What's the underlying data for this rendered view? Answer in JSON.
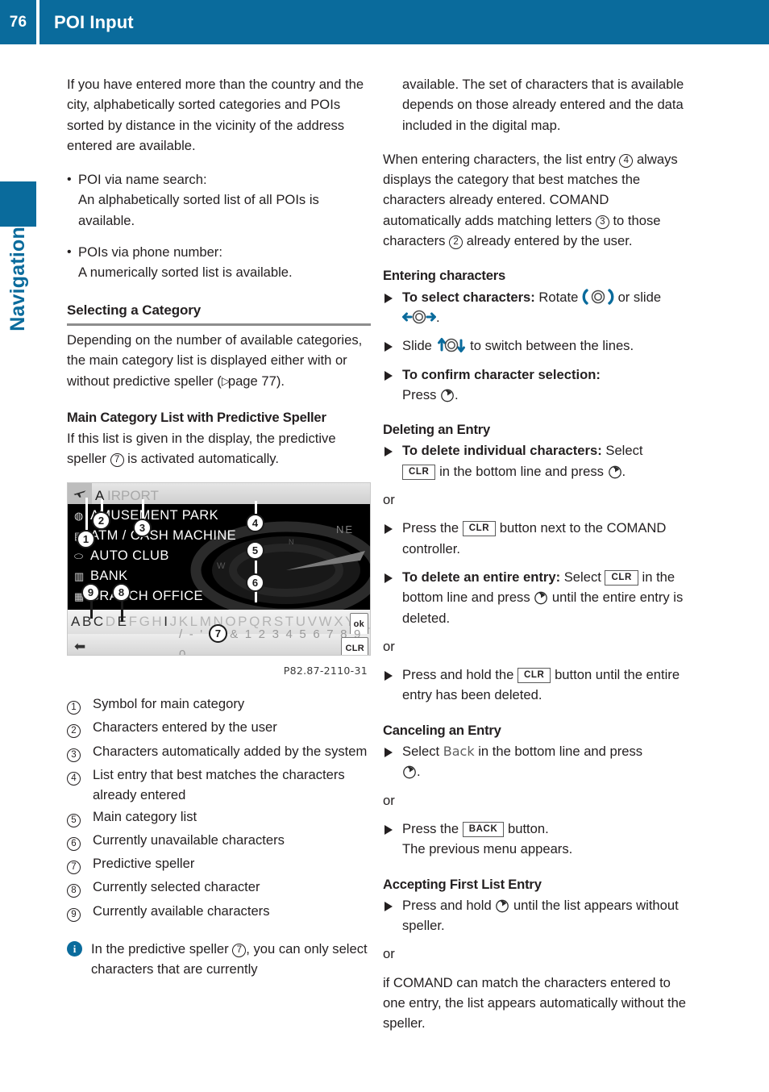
{
  "header": {
    "page_number": "76",
    "title": "POI Input",
    "accent_color": "#0a6b9c"
  },
  "side_tab": {
    "label": "Navigation"
  },
  "left_column": {
    "intro_paragraph": "If you have entered more than the country and the city, alphabetically sorted categories and POIs sorted by distance in the vicinity of the address entered are available.",
    "bullets": [
      {
        "line1": "POI via name search:",
        "line2": "An alphabetically sorted list of all POIs is available."
      },
      {
        "line1": "POIs via phone number:",
        "line2": "A numerically sorted list is available."
      }
    ],
    "section_heading": "Selecting a Category",
    "section_paragraph_a": "Depending on the number of available categories, the main category list is displayed either with or without predictive speller (",
    "section_paragraph_page_ref": "page 77",
    "section_paragraph_b": ").",
    "sub_heading": "Main Category List with Predictive Speller",
    "sub_paragraph_a": "If this list is given in the display, the predictive speller",
    "sub_paragraph_ref": "7",
    "sub_paragraph_b": "is activated automatically.",
    "figure": {
      "caption": "P82.87-2110-31",
      "top_row": {
        "main_category_icon": "airplane-icon",
        "entered_characters": "A",
        "auto_added_characters": "IRPORT"
      },
      "list_items": [
        {
          "icon": "ferris-wheel-icon",
          "label": "AMUSEMENT PARK"
        },
        {
          "icon": "atm-icon",
          "label": "ATM / CASH MACHINE"
        },
        {
          "icon": "auto-club-icon",
          "label": "AUTO CLUB"
        },
        {
          "icon": "bank-icon",
          "label": "BANK"
        },
        {
          "icon": "branch-office-icon",
          "label": "BRANCH OFFICE"
        }
      ],
      "speller_available": "ABC",
      "speller_selected": "E",
      "speller_rest_1": "D",
      "speller_rest_2": "FGH",
      "speller_active_i": "I",
      "speller_rest_3": "JKLMNOPQRSTUVWXYZ_",
      "ok_key": "ok",
      "clr_key": "CLR",
      "symbols_row": "/ - ' . , & 1 2 3 4 5 6 7 8 9 0",
      "back_arrow_icon": "back-arrow-icon",
      "compass_label": "NE",
      "callouts": [
        "1",
        "2",
        "3",
        "4",
        "5",
        "6",
        "7",
        "8",
        "9"
      ]
    },
    "legend": [
      {
        "num": "1",
        "text": "Symbol for main category"
      },
      {
        "num": "2",
        "text": "Characters entered by the user"
      },
      {
        "num": "3",
        "text": "Characters automatically added by the system"
      },
      {
        "num": "4",
        "text": "List entry that best matches the characters already entered"
      },
      {
        "num": "5",
        "text": "Main category list"
      },
      {
        "num": "6",
        "text": "Currently unavailable characters"
      },
      {
        "num": "7",
        "text": "Predictive speller"
      },
      {
        "num": "8",
        "text": "Currently selected character"
      },
      {
        "num": "9",
        "text": "Currently available characters"
      }
    ],
    "note": {
      "icon": "info-icon",
      "text_a": "In the predictive speller",
      "ref": "7",
      "text_b": ", you can only select characters that are currently"
    }
  },
  "right_column": {
    "continuation_paragraph": "available. The set of characters that is available depends on those already entered and the data included in the digital map.",
    "paragraph2_a": "When entering characters, the list entry",
    "paragraph2_ref1": "4",
    "paragraph2_b": "always displays the category that best matches the characters already entered. COMAND automatically adds matching letters",
    "paragraph2_ref2": "3",
    "paragraph2_c": "to those characters",
    "paragraph2_ref3": "2",
    "paragraph2_d": "already entered by the user.",
    "sections": [
      {
        "heading": "Entering characters",
        "steps": [
          {
            "bold": "To select characters:",
            "text_a": "Rotate",
            "glyph1": "rotate-controller-icon",
            "text_b": "or slide",
            "glyph2": "slide-horizontal-controller-icon",
            "text_c": "."
          },
          {
            "bold": "",
            "text_a": "Slide",
            "glyph1": "slide-vertical-controller-icon",
            "text_b": "to switch between the lines.",
            "glyph2": "",
            "text_c": ""
          },
          {
            "bold": "To confirm character selection:",
            "text_a": "Press",
            "glyph1": "press-controller-icon",
            "text_b": "",
            "glyph2": "",
            "text_c": "."
          }
        ]
      },
      {
        "heading": "Deleting an Entry",
        "steps": [
          {
            "bold": "To delete individual characters:",
            "text_a": "Select",
            "key": "CLR",
            "text_b": "in the bottom line and press",
            "glyph": "press-controller-icon",
            "text_c": "."
          },
          {
            "or": "or"
          },
          {
            "bold": "",
            "text_a": "Press the",
            "key": "CLR",
            "text_b": "button next to the COMAND controller.",
            "glyph": "",
            "text_c": ""
          },
          {
            "bold": "To delete an entire entry:",
            "text_a": "Select",
            "key": "CLR",
            "text_b": "in the bottom line and press",
            "glyph": "press-controller-icon",
            "text_c": "until the entire entry is deleted."
          },
          {
            "or": "or"
          },
          {
            "bold": "",
            "text_a": "Press and hold the",
            "key": "CLR",
            "text_b": "button until the entire entry has been deleted.",
            "glyph": "",
            "text_c": ""
          }
        ]
      },
      {
        "heading": "Canceling an Entry",
        "steps": [
          {
            "bold": "",
            "text_a": "Select",
            "ui_label": "Back",
            "text_b": "in the bottom line and press",
            "glyph": "press-controller-icon",
            "text_c": "."
          },
          {
            "or": "or"
          },
          {
            "bold": "",
            "text_a": "Press the",
            "key": "BACK",
            "text_b": "button.",
            "extra_line": "The previous menu appears."
          }
        ]
      },
      {
        "heading": "Accepting First List Entry",
        "steps": [
          {
            "bold": "",
            "text_a": "Press and hold",
            "glyph": "press-controller-icon",
            "text_b": "until the list appears without speller."
          },
          {
            "or": "or"
          }
        ],
        "closing_paragraph": "if COMAND can match the characters entered to one entry, the list appears automatically without the speller."
      }
    ]
  }
}
